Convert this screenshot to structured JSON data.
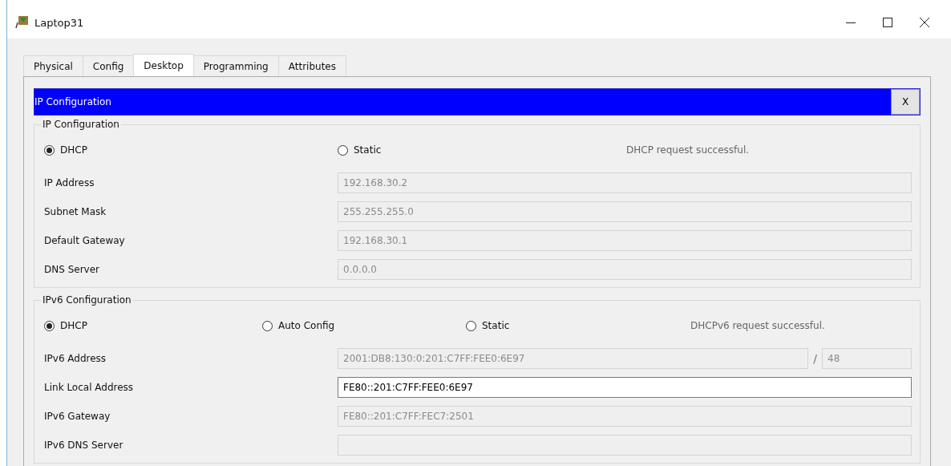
{
  "window": {
    "title": "Laptop31"
  },
  "tabs": [
    {
      "label": "Physical",
      "selected": false
    },
    {
      "label": "Config",
      "selected": false
    },
    {
      "label": "Desktop",
      "selected": true
    },
    {
      "label": "Programming",
      "selected": false
    },
    {
      "label": "Attributes",
      "selected": false
    }
  ],
  "panel": {
    "title": "IP Configuration",
    "close_label": "X"
  },
  "groups": [
    {
      "title": "IP Configuration",
      "modes": [
        {
          "label": "DHCP",
          "selected": true
        },
        {
          "label": "Static",
          "selected": false
        }
      ],
      "status": "DHCP request successful.",
      "fields": [
        {
          "label": "IP Address",
          "value": "192.168.30.2",
          "disabled": true
        },
        {
          "label": "Subnet Mask",
          "value": "255.255.255.0",
          "disabled": true
        },
        {
          "label": "Default Gateway",
          "value": "192.168.30.1",
          "disabled": true
        },
        {
          "label": "DNS Server",
          "value": "0.0.0.0",
          "disabled": true
        }
      ]
    },
    {
      "title": "IPv6 Configuration",
      "modes": [
        {
          "label": "DHCP",
          "selected": true
        },
        {
          "label": "Auto Config",
          "selected": false
        },
        {
          "label": "Static",
          "selected": false
        }
      ],
      "status": "DHCPv6 request successful.",
      "fields": [
        {
          "label": "IPv6 Address",
          "value": "2001:DB8:130:0:201:C7FF:FEE0:6E97",
          "disabled": true,
          "separator": "/",
          "prefix": "48"
        },
        {
          "label": "Link Local Address",
          "value": "FE80::201:C7FF:FEE0:6E97",
          "disabled": false
        },
        {
          "label": "IPv6 Gateway",
          "value": "FE80::201:C7FF:FEC7:2501",
          "disabled": true
        },
        {
          "label": "IPv6 DNS Server",
          "disabled": true
        }
      ]
    }
  ]
}
